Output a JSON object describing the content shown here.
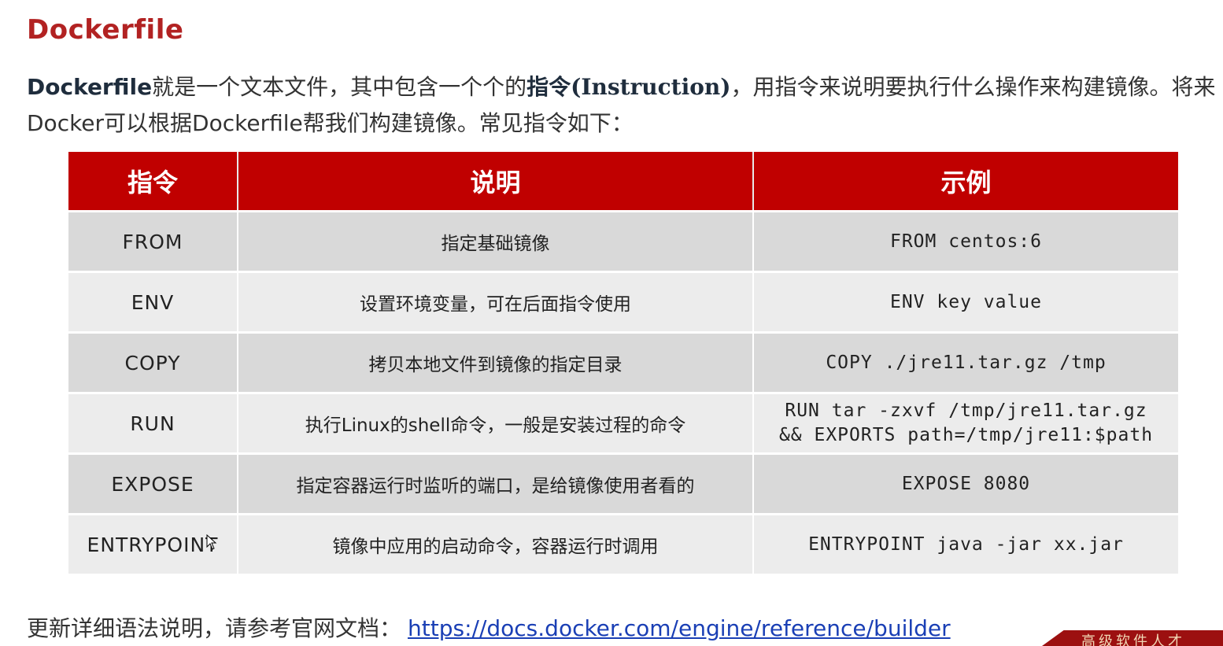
{
  "page": {
    "title": "Dockerfile",
    "intro": {
      "lead": "Dockerfile",
      "text1": "就是一个文本文件，其中包含一个个的",
      "instr_cn": "指令",
      "instr_en": "(Instruction)",
      "text2": "，用指令来说明要执行什么操作来构建镜像。将来Docker可以根据Dockerfile帮我们构建镜像。常见指令如下："
    }
  },
  "table": {
    "headers": [
      "指令",
      "说明",
      "示例"
    ],
    "rows": [
      {
        "instruction": "FROM",
        "description": "指定基础镜像",
        "example": [
          "FROM centos:6"
        ]
      },
      {
        "instruction": "ENV",
        "description": "设置环境变量，可在后面指令使用",
        "example": [
          "ENV key value"
        ]
      },
      {
        "instruction": "COPY",
        "description": "拷贝本地文件到镜像的指定目录",
        "example": [
          "COPY ./jre11.tar.gz /tmp"
        ]
      },
      {
        "instruction": "RUN",
        "description": "执行Linux的shell命令，一般是安装过程的命令",
        "example": [
          "RUN tar -zxvf /tmp/jre11.tar.gz",
          "&& EXPORTS path=/tmp/jre11:$path"
        ]
      },
      {
        "instruction": "EXPOSE",
        "description": "指定容器运行时监听的端口，是给镜像使用者看的",
        "example": [
          "EXPOSE 8080"
        ]
      },
      {
        "instruction": "ENTRYPOINT",
        "description": "镜像中应用的启动命令，容器运行时调用",
        "example": [
          "ENTRYPOINT java -jar xx.jar"
        ]
      }
    ]
  },
  "footer": {
    "text": "更新详细语法说明，请参考官网文档：",
    "link": "https://docs.docker.com/engine/reference/builder"
  },
  "corner_banner": {
    "text": "高级软件人才"
  },
  "colors": {
    "title": "#b22222",
    "header_bg": "#c00000",
    "row_dark": "#d9d9d9",
    "row_light": "#ececec",
    "link": "#1a3fb5"
  }
}
